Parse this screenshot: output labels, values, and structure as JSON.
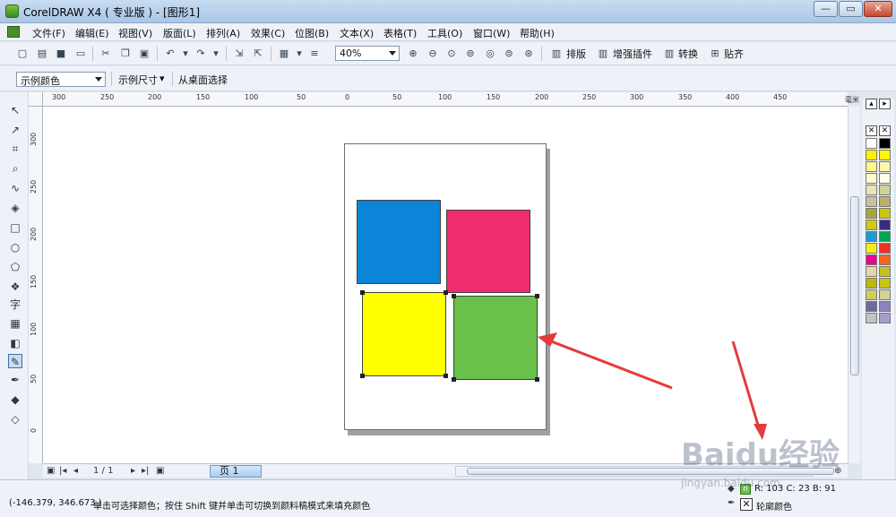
{
  "window": {
    "title": "CorelDRAW X4 ( 专业版 ) - [图形1]",
    "buttons": {
      "minimize": "—",
      "maximize": "▭",
      "close": "✕"
    }
  },
  "menubar": {
    "items": [
      "文件(F)",
      "编辑(E)",
      "视图(V)",
      "版面(L)",
      "排列(A)",
      "效果(C)",
      "位图(B)",
      "文本(X)",
      "表格(T)",
      "工具(O)",
      "窗口(W)",
      "帮助(H)"
    ]
  },
  "toolbar": {
    "zoom_value": "40%",
    "buttons": [
      "排版",
      "增强插件",
      "转换",
      "贴齐"
    ]
  },
  "propertybar": {
    "sample_color": "示例颜色",
    "sample_size": "示例尺寸",
    "select_from_desktop": "从桌面选择"
  },
  "rulers": {
    "unit": "毫米",
    "h_labels": [
      "300",
      "250",
      "200",
      "150",
      "100",
      "50",
      "0",
      "50",
      "100",
      "150",
      "200",
      "250",
      "300",
      "350",
      "400",
      "450"
    ],
    "v_labels": [
      "300",
      "250",
      "200",
      "150",
      "100",
      "50",
      "0"
    ]
  },
  "shapes": [
    {
      "name": "blue-rectangle",
      "color": "#0b85d8"
    },
    {
      "name": "pink-rectangle",
      "color": "#ee2d6e"
    },
    {
      "name": "yellow-rectangle",
      "color": "#ffff00"
    },
    {
      "name": "green-rectangle",
      "color": "#69c04b"
    }
  ],
  "pagenav": {
    "page_counter": "1 / 1",
    "page_tab": "页 1"
  },
  "statusbar": {
    "coordinates": "(-146.379, 346.673 )",
    "hint": "单击可选择颜色；按住 Shift 键并单击可切换到颜料稿模式来填充颜色",
    "fill_info": "R: 103 C: 23  B: 91",
    "outline_label": "轮廓颜色"
  },
  "palette": {
    "colors": [
      "#ffffff",
      "#000000",
      "#fff200",
      "#fff600",
      "#fff68f",
      "#fff8a8",
      "#fffacd",
      "#fffde6",
      "#e8e6b0",
      "#cfd29c",
      "#c8c2a0",
      "#bbb06b",
      "#a5a83d",
      "#c9c90b",
      "#d2c910",
      "#3b2a80",
      "#1a9cd8",
      "#00a651",
      "#f7ec13",
      "#ee3124",
      "#ec008c",
      "#f26522",
      "#e8d5a8",
      "#c8c020",
      "#bfb80b",
      "#c9c40f",
      "#cfcd5d",
      "#d5d39a",
      "#6b6b9e",
      "#8c82bf",
      "#c4c4c4",
      "#a59fc8"
    ]
  },
  "watermark": {
    "brand": "Baidu经验",
    "url": "jingyan.baidu.com"
  }
}
